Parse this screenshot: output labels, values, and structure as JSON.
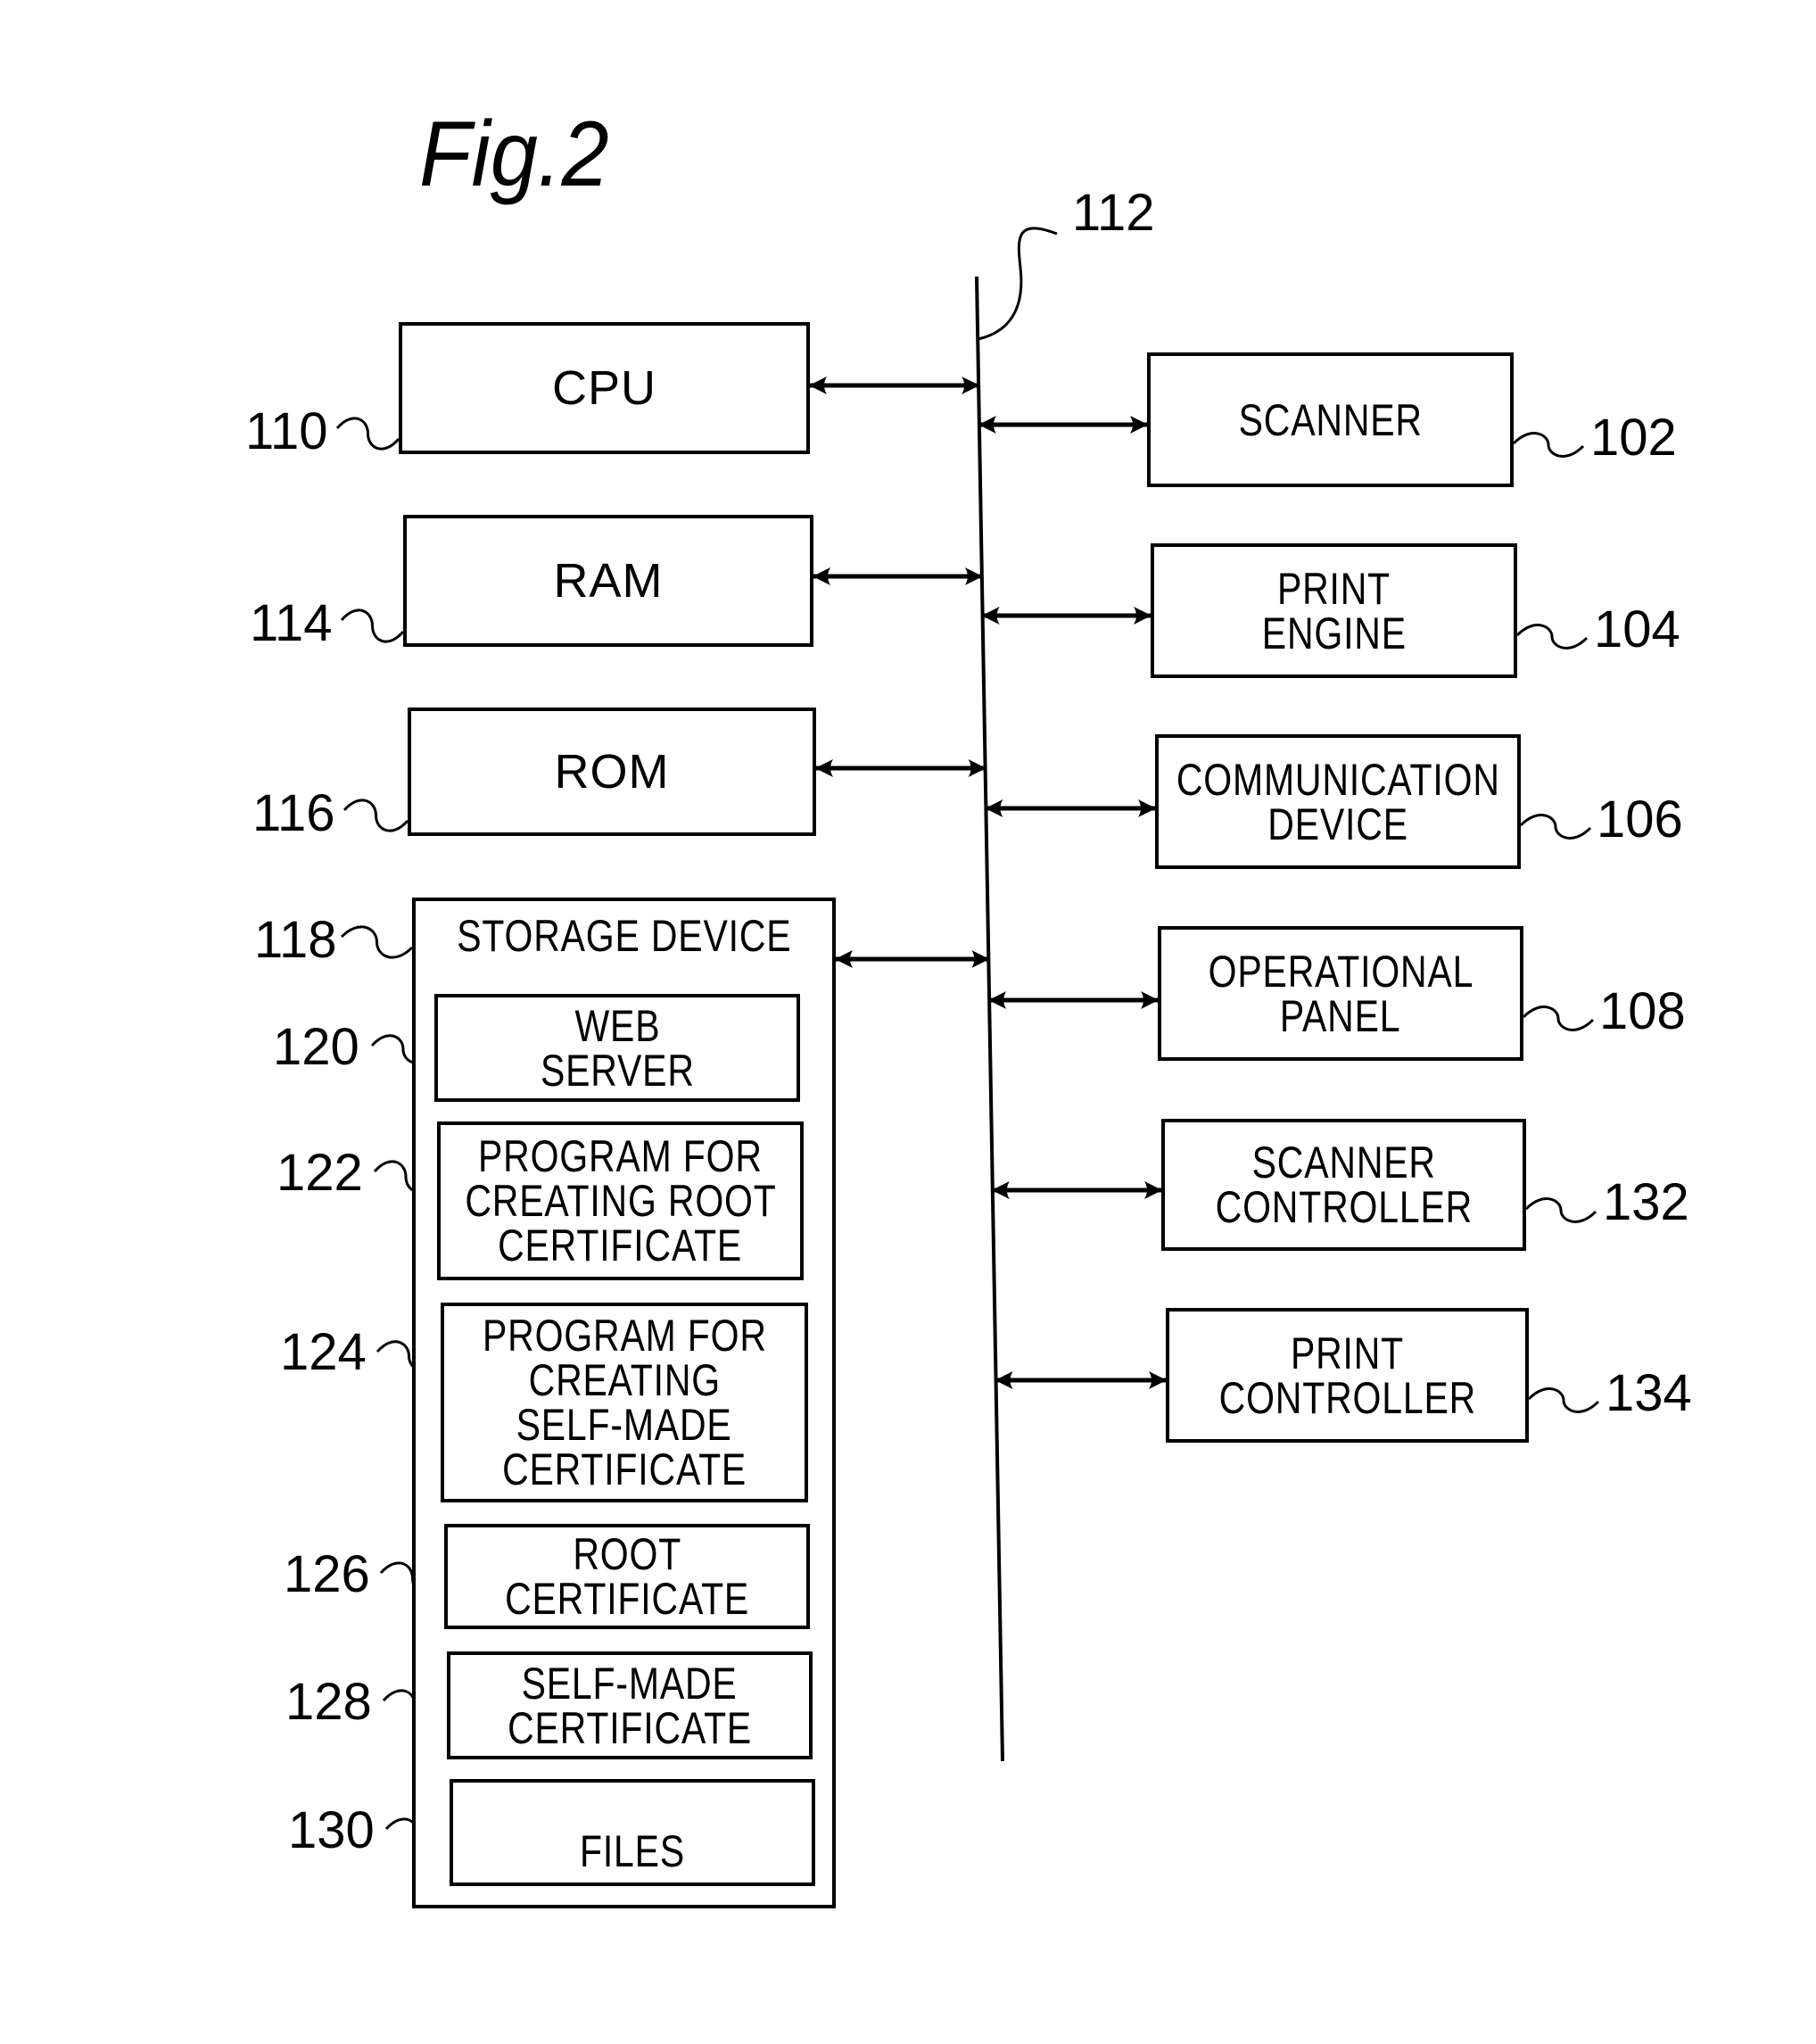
{
  "figure": {
    "title": "Fig.2",
    "bus_ref": "112"
  },
  "left_components": [
    {
      "ref": "110",
      "label": [
        "CPU"
      ]
    },
    {
      "ref": "114",
      "label": [
        "RAM"
      ]
    },
    {
      "ref": "116",
      "label": [
        "ROM"
      ]
    }
  ],
  "storage": {
    "ref": "118",
    "label": "STORAGE DEVICE",
    "items": [
      {
        "ref": "120",
        "label": [
          "WEB",
          "SERVER"
        ]
      },
      {
        "ref": "122",
        "label": [
          "PROGRAM FOR",
          "CREATING ROOT",
          "CERTIFICATE"
        ]
      },
      {
        "ref": "124",
        "label": [
          "PROGRAM FOR",
          "CREATING",
          "SELF-MADE",
          "CERTIFICATE"
        ]
      },
      {
        "ref": "126",
        "label": [
          "ROOT",
          "CERTIFICATE"
        ]
      },
      {
        "ref": "128",
        "label": [
          "SELF-MADE",
          "CERTIFICATE"
        ]
      },
      {
        "ref": "130",
        "label": [
          "FILES"
        ]
      }
    ]
  },
  "right_components": [
    {
      "ref": "102",
      "label": [
        "SCANNER"
      ]
    },
    {
      "ref": "104",
      "label": [
        "PRINT",
        "ENGINE"
      ]
    },
    {
      "ref": "106",
      "label": [
        "COMMUNICATION",
        "DEVICE"
      ]
    },
    {
      "ref": "108",
      "label": [
        "OPERATIONAL",
        "PANEL"
      ]
    },
    {
      "ref": "132",
      "label": [
        "SCANNER",
        "CONTROLLER"
      ]
    },
    {
      "ref": "134",
      "label": [
        "PRINT",
        "CONTROLLER"
      ]
    }
  ]
}
